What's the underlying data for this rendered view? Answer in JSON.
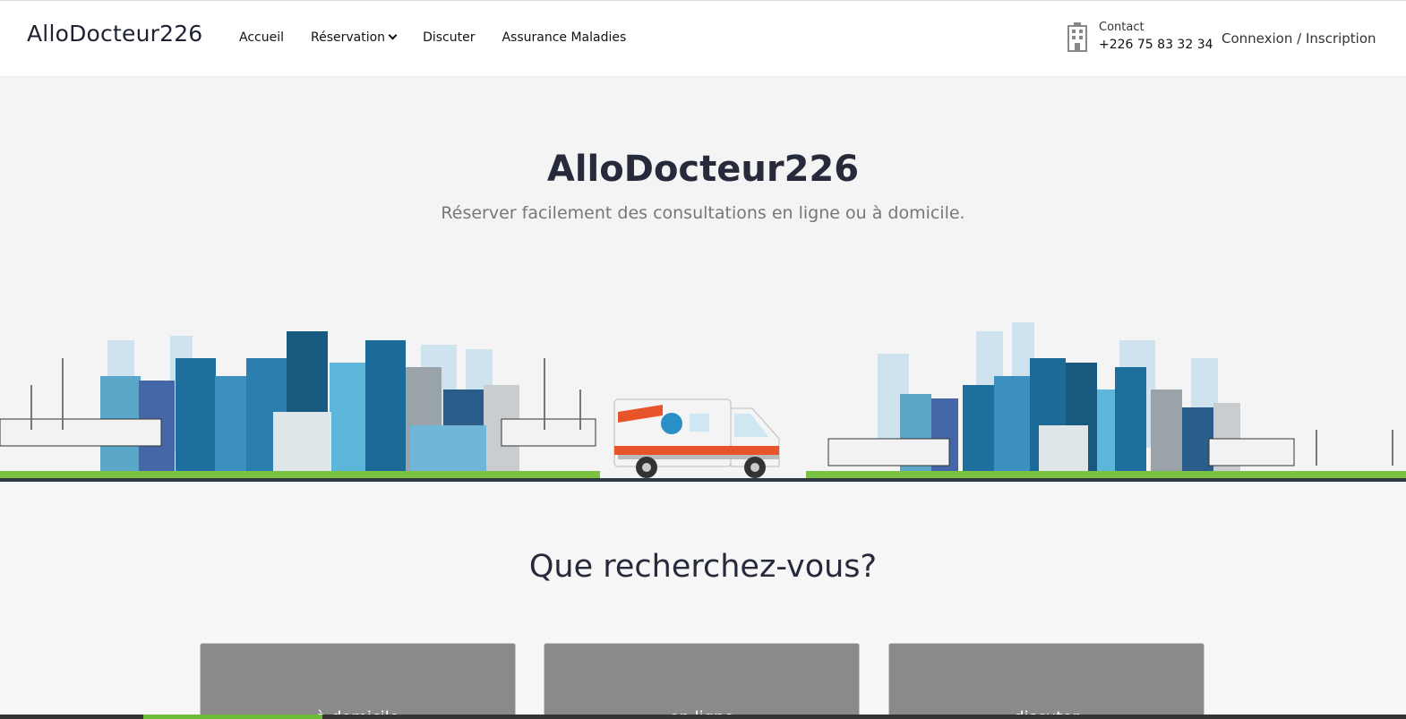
{
  "header": {
    "brand": "AlloDocteur226",
    "nav": [
      {
        "label": "Accueil"
      },
      {
        "label": "Réservation"
      },
      {
        "label": "Discuter"
      },
      {
        "label": "Assurance Maladies"
      }
    ],
    "contact": {
      "label": "Contact",
      "phone": "+226 75 83 32 34"
    },
    "auth": {
      "login": "Connexion",
      "separator": " / ",
      "signup": "Inscription"
    }
  },
  "hero": {
    "title": "AlloDocteur226",
    "subtitle": "Réserver facilement des consultations en ligne ou à domicile."
  },
  "search_section": {
    "title": "Que recherchez-vous?",
    "cards": [
      {
        "label": "à domicile"
      },
      {
        "label": "en ligne"
      },
      {
        "label": "discuter"
      }
    ]
  },
  "colors": {
    "card_bg": "#8a8a8a",
    "ambulance_red": "#e8542a",
    "building_blue": "#1f6f9e",
    "grass": "#7cc242"
  }
}
